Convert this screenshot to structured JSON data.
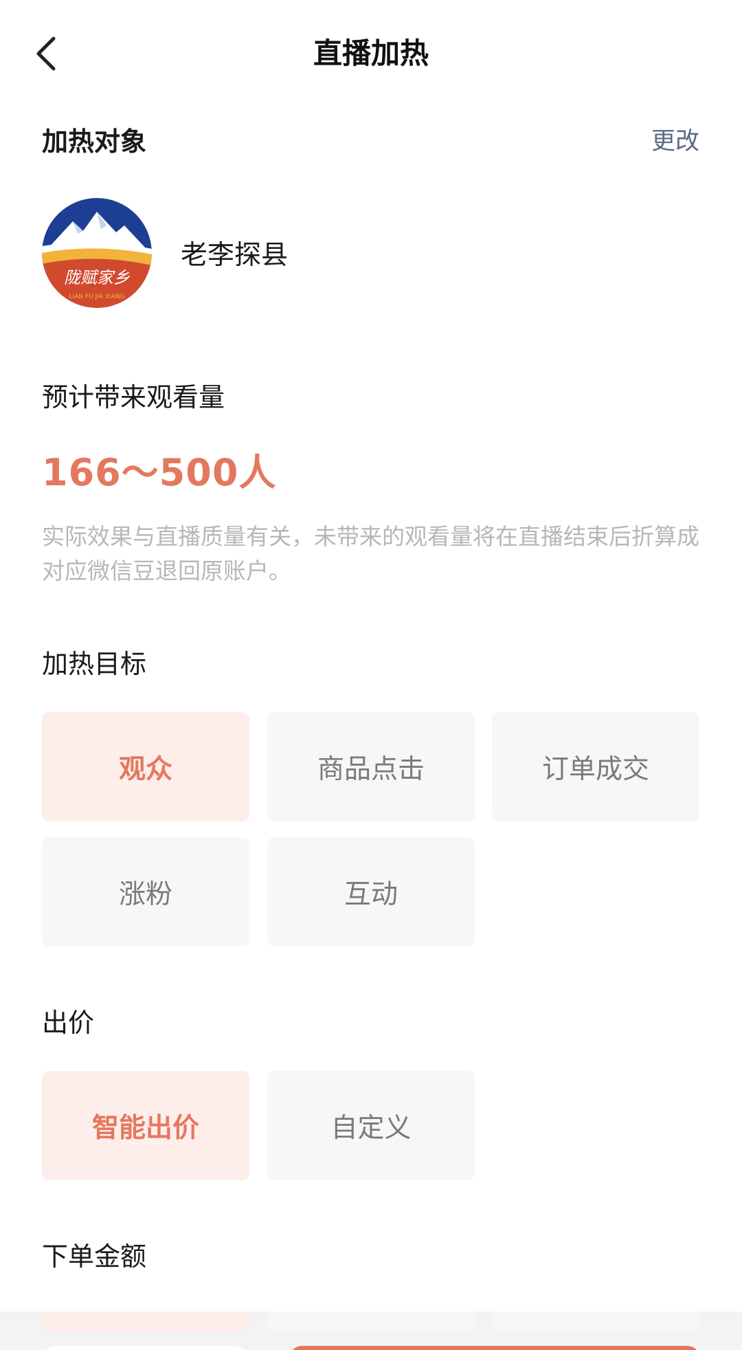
{
  "header": {
    "title": "直播加热",
    "back_icon": "chevron-left-icon"
  },
  "target": {
    "section_title": "加热对象",
    "change_label": "更改",
    "account_name": "老李探县",
    "logo_text": "陇赋家乡",
    "logo_subtext": "LIAN FU JIA XIANG"
  },
  "estimate": {
    "section_title": "预计带来观看量",
    "value": "166～500人",
    "note": "实际效果与直播质量有关，未带来的观看量将在直播结束后折算成对应微信豆退回原账户。"
  },
  "goal": {
    "section_title": "加热目标",
    "options": [
      {
        "label": "观众",
        "selected": true
      },
      {
        "label": "商品点击",
        "selected": false
      },
      {
        "label": "订单成交",
        "selected": false
      },
      {
        "label": "涨粉",
        "selected": false
      },
      {
        "label": "互动",
        "selected": false
      }
    ]
  },
  "bid": {
    "section_title": "出价",
    "options": [
      {
        "label": "智能出价",
        "selected": true
      },
      {
        "label": "自定义",
        "selected": false
      }
    ]
  },
  "amount": {
    "section_title": "下单金额"
  },
  "colors": {
    "accent": "#e4785e",
    "accent_bg": "#fdeeeb",
    "link": "#5c6a85",
    "hint": "#b7b7b7"
  }
}
